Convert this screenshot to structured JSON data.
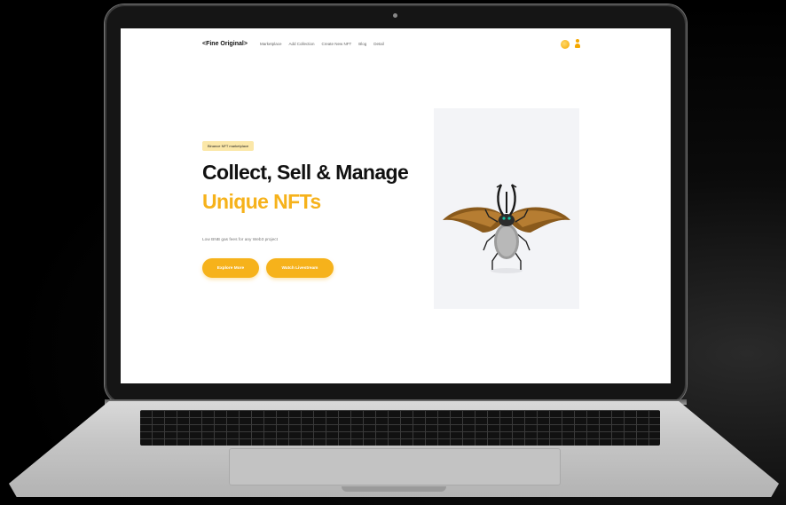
{
  "nav": {
    "brand": "<Fine Original>",
    "links": [
      "Marketplace",
      "Add Collection",
      "Create New NFT",
      "Blog",
      "Detail"
    ]
  },
  "hero": {
    "badge": "Binance NFT marketplace",
    "title_line1": "Collect, Sell & Manage",
    "title_line2": "Unique NFTs",
    "subtitle": "Low BNB gas fees for any Web3 project",
    "primary_button": "Explore More",
    "secondary_button": "Watch Livestream"
  },
  "colors": {
    "accent": "#f6b21b",
    "badge_bg": "#fbe7a8"
  },
  "icons": [
    "coin-icon",
    "user-icon",
    "camera-icon"
  ]
}
